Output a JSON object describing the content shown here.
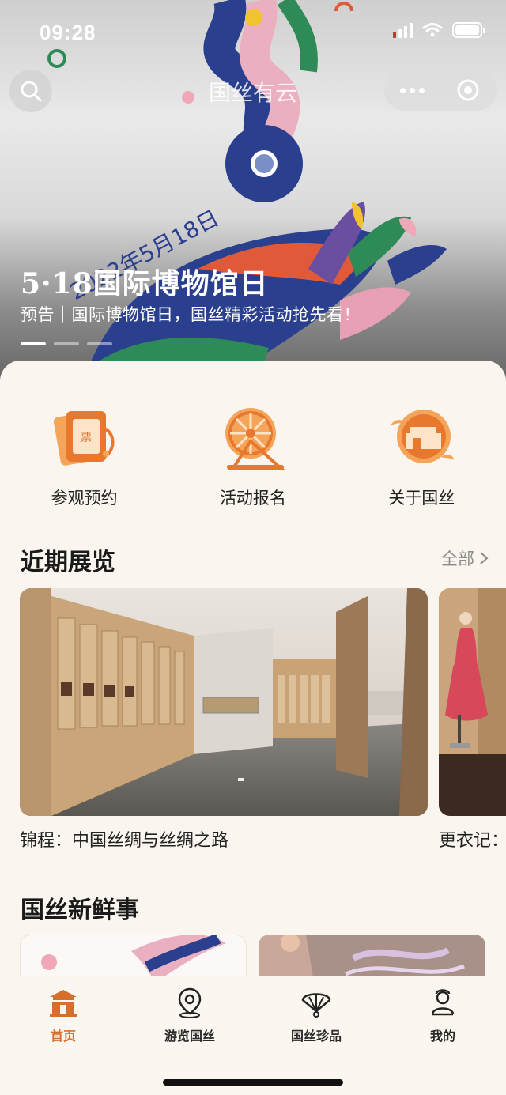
{
  "status_bar": {
    "time": "09:28"
  },
  "nav": {
    "title": "国丝有云",
    "search_icon": "search-icon",
    "more_icon": "more-dots-icon",
    "target_icon": "target-icon"
  },
  "hero": {
    "date_text": "2022年5月18日",
    "title": "5·18国际博物馆日",
    "subtitle": "预告｜国际博物馆日，国丝精彩活动抢先看！",
    "slide_count": 3,
    "active_slide": 1
  },
  "quick_actions": [
    {
      "label": "参观预约",
      "icon": "ticket-icon"
    },
    {
      "label": "活动报名",
      "icon": "spinning-wheel-icon"
    },
    {
      "label": "关于国丝",
      "icon": "museum-building-icon"
    }
  ],
  "exhibitions": {
    "title": "近期展览",
    "all_label": "全部",
    "items": [
      {
        "caption": "锦程：中国丝绸与丝绸之路"
      },
      {
        "caption": "更衣记："
      }
    ]
  },
  "news": {
    "title": "国丝新鲜事"
  },
  "tabbar": {
    "items": [
      {
        "label": "首页",
        "icon": "home-gate-icon",
        "active": true
      },
      {
        "label": "游览国丝",
        "icon": "location-pin-icon",
        "active": false
      },
      {
        "label": "国丝珍品",
        "icon": "folding-fan-icon",
        "active": false
      },
      {
        "label": "我的",
        "icon": "person-icon",
        "active": false
      }
    ]
  },
  "colors": {
    "accent": "#d66f2b",
    "background": "#fbf5ef"
  }
}
